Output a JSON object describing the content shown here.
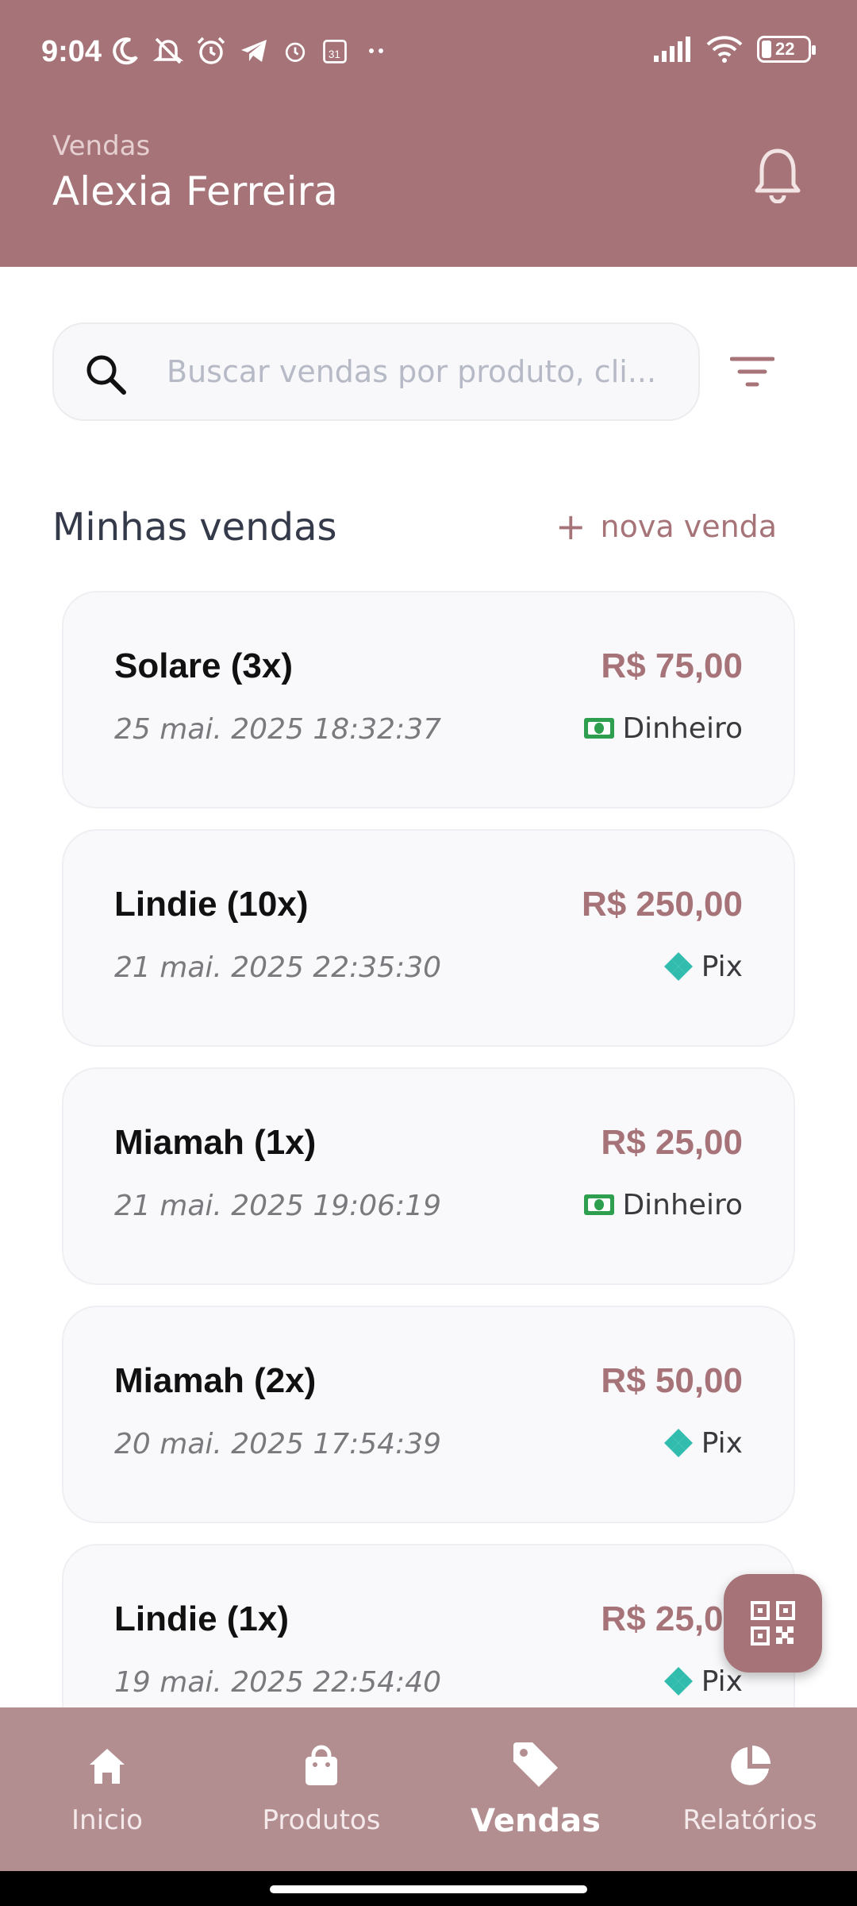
{
  "status_bar": {
    "time": "9:04",
    "battery": "22"
  },
  "header": {
    "subtitle": "Vendas",
    "title": "Alexia Ferreira"
  },
  "search": {
    "placeholder": "Buscar vendas por produto, cli..."
  },
  "section": {
    "title": "Minhas vendas",
    "new_sale_label": "nova venda"
  },
  "sales": [
    {
      "name": "Solare  (3x)",
      "price": "R$ 75,00",
      "date": "25 mai. 2025 18:32:37",
      "payment": "Dinheiro",
      "payment_icon": "cash-icon"
    },
    {
      "name": "Lindie (10x)",
      "price": "R$ 250,00",
      "date": "21 mai. 2025 22:35:30",
      "payment": "Pix",
      "payment_icon": "pix-icon"
    },
    {
      "name": "Miamah (1x)",
      "price": "R$ 25,00",
      "date": "21 mai. 2025 19:06:19",
      "payment": "Dinheiro",
      "payment_icon": "cash-icon"
    },
    {
      "name": "Miamah (2x)",
      "price": "R$ 50,00",
      "date": "20 mai. 2025 17:54:39",
      "payment": "Pix",
      "payment_icon": "pix-icon"
    },
    {
      "name": "Lindie (1x)",
      "price": "R$ 25,00",
      "date": "19 mai. 2025 22:54:40",
      "payment": "Pix",
      "payment_icon": "pix-icon"
    }
  ],
  "nav": {
    "items": [
      {
        "label": "Inicio",
        "icon": "home-icon"
      },
      {
        "label": "Produtos",
        "icon": "shopping-bag-icon"
      },
      {
        "label": "Vendas",
        "icon": "tag-icon",
        "active": true
      },
      {
        "label": "Relatórios",
        "icon": "pie-chart-icon"
      }
    ]
  },
  "colors": {
    "brand": "#a67478",
    "nav_bg": "#b38e91",
    "pix": "#32bcad",
    "cash": "#2e9e4f"
  }
}
